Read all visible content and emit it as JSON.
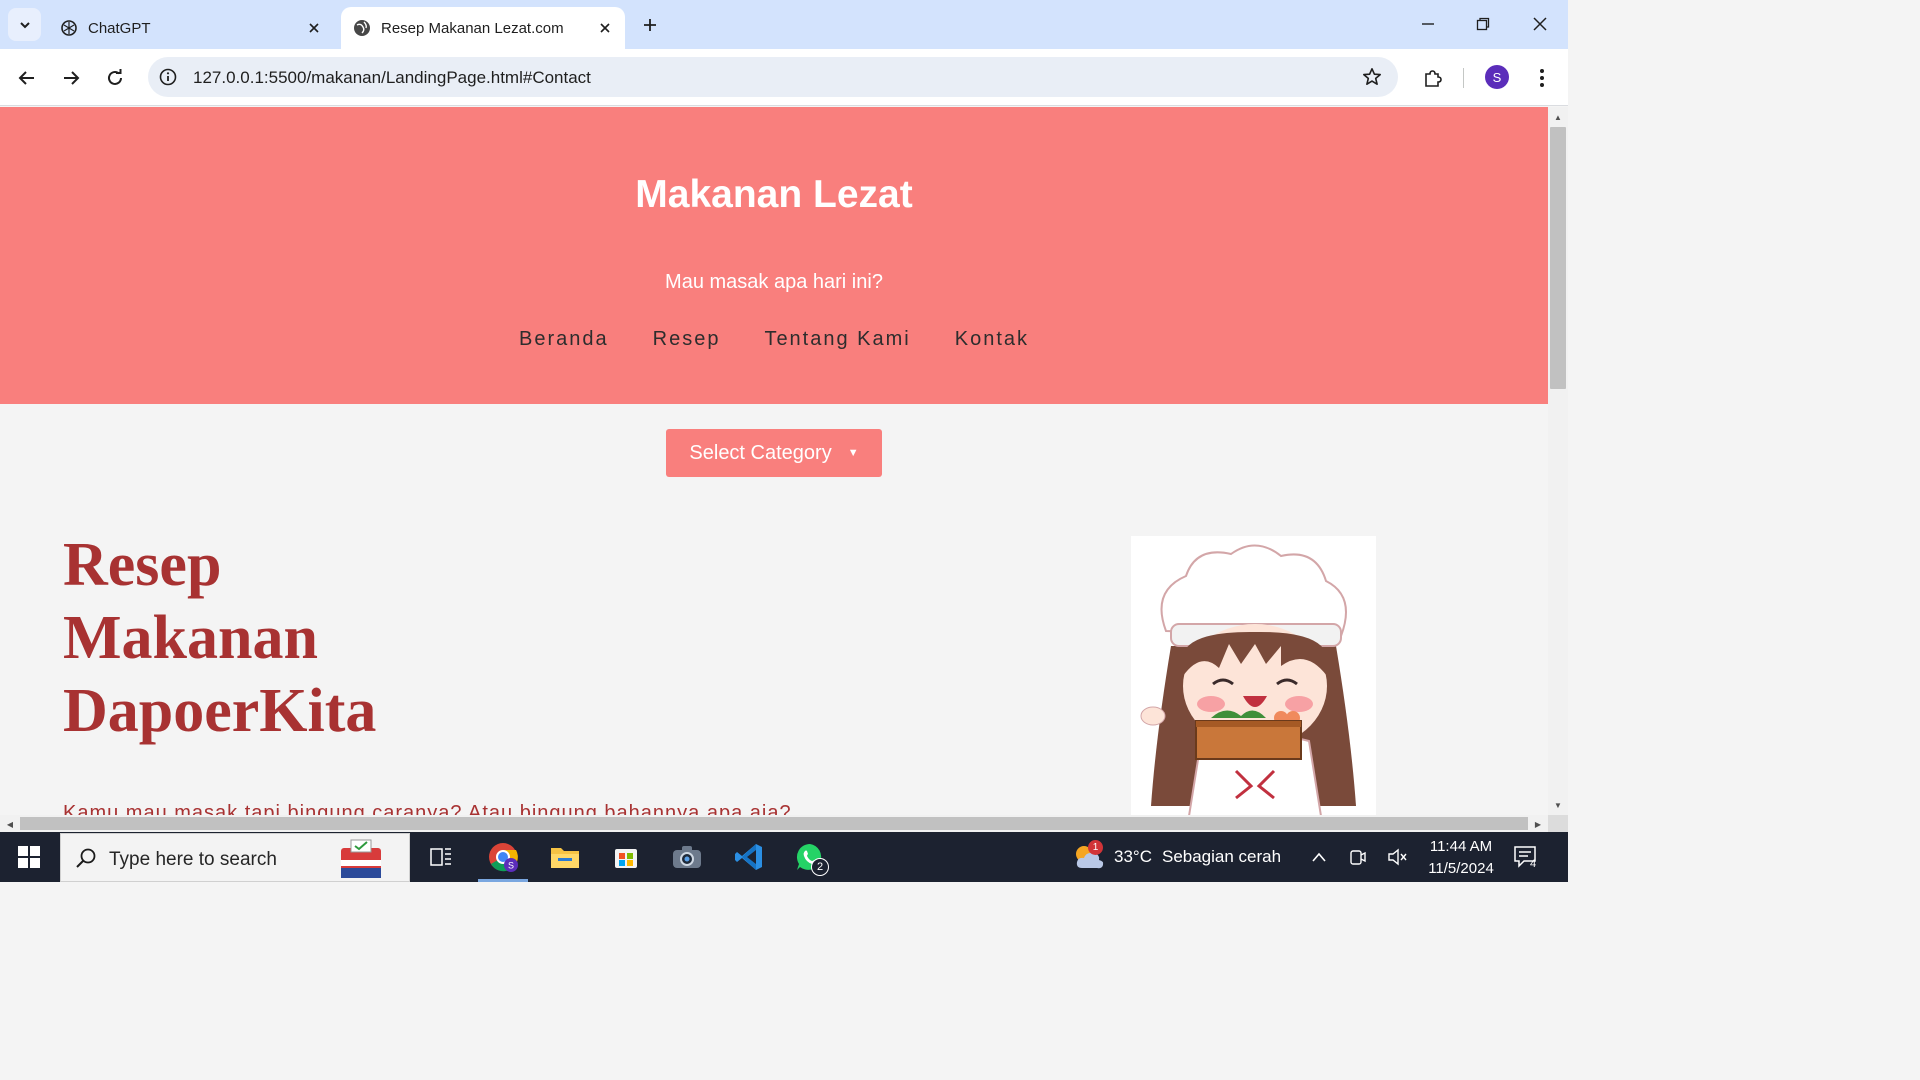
{
  "browser": {
    "tabs": [
      {
        "title": "ChatGPT",
        "favicon": "chatgpt-icon",
        "active": false
      },
      {
        "title": "Resep Makanan Lezat.com",
        "favicon": "globe-icon",
        "active": true
      }
    ],
    "url": "127.0.0.1:5500/makanan/LandingPage.html#Contact",
    "profile_initial": "S"
  },
  "page": {
    "header": {
      "title": "Makanan Lezat",
      "tagline": "Mau masak apa hari ini?",
      "nav": [
        "Beranda",
        "Resep",
        "Tentang Kami",
        "Kontak"
      ]
    },
    "category_select": {
      "label": "Select Category",
      "caret": "▼"
    },
    "hero": {
      "title_lines": [
        "Resep",
        "Makanan",
        "DapoerKita"
      ],
      "description": "Kamu mau masak tapi bingung caranya? Atau bingung bahannya apa aja?"
    },
    "colors": {
      "header_bg": "#f97f7d",
      "hero_text": "#a83232",
      "page_bg": "#f4f4f4"
    }
  },
  "taskbar": {
    "search_placeholder": "Type here to search",
    "apps": [
      {
        "name": "task-view-icon",
        "badge": ""
      },
      {
        "name": "chrome-icon",
        "badge": ""
      },
      {
        "name": "file-explorer-icon",
        "badge": ""
      },
      {
        "name": "microsoft-store-icon",
        "badge": ""
      },
      {
        "name": "camera-icon",
        "badge": ""
      },
      {
        "name": "vscode-icon",
        "badge": ""
      },
      {
        "name": "whatsapp-icon",
        "badge": "2"
      }
    ],
    "weather": {
      "temp": "33°C",
      "desc": "Sebagian cerah",
      "badge": "1"
    },
    "clock": {
      "time": "11:44 AM",
      "date": "11/5/2024"
    },
    "notification_count": "4"
  }
}
